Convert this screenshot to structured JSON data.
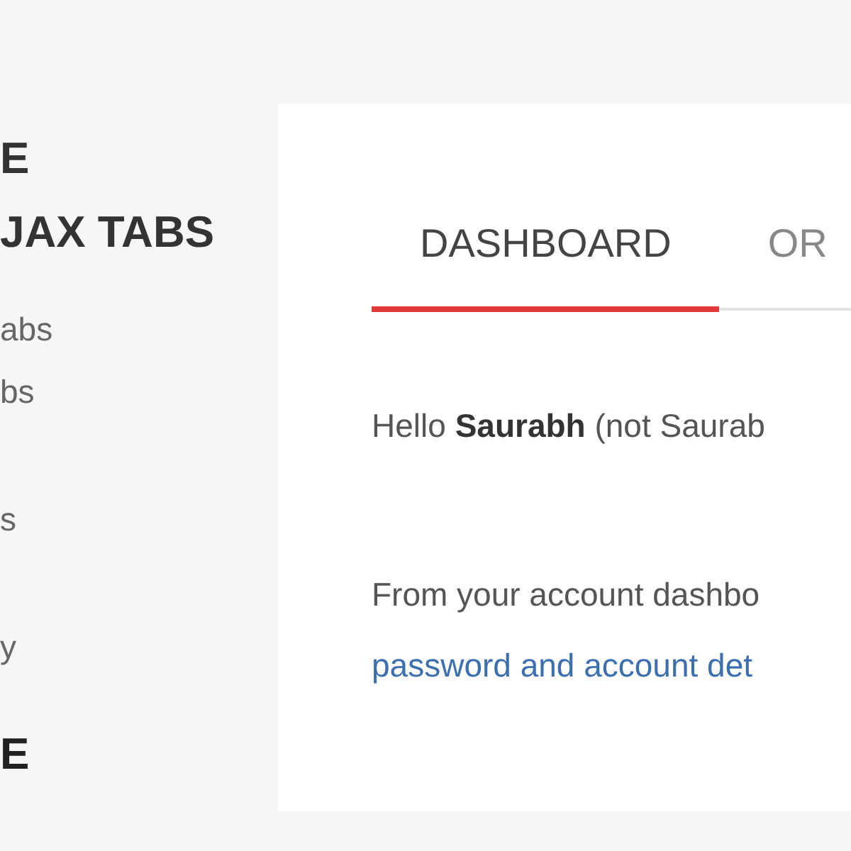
{
  "sidebar": {
    "headings": [
      "E",
      "JAX TABS"
    ],
    "items": [
      "abs",
      "bs",
      "s",
      "y"
    ],
    "footer_heading": "E"
  },
  "account": {
    "tabs": [
      {
        "label": "DASHBOARD",
        "selected": true
      },
      {
        "label": "OR",
        "selected": false
      }
    ],
    "greeting": "Hello **Saurabh** (not Saurab",
    "intro": "From your account dashbo",
    "link": "password and account det"
  }
}
